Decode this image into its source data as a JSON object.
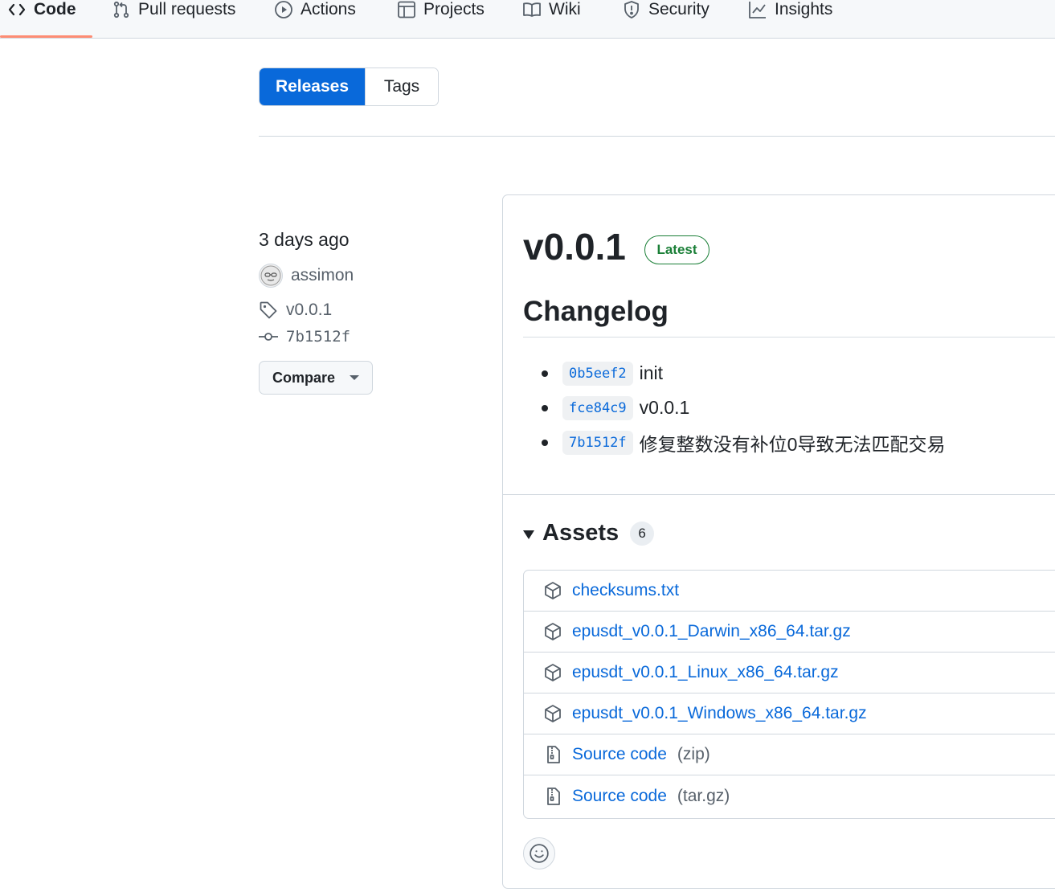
{
  "nav": {
    "tabs": [
      {
        "label": "Code",
        "icon": "code-icon",
        "selected": true
      },
      {
        "label": "Pull requests",
        "icon": "pull-request-icon"
      },
      {
        "label": "Actions",
        "icon": "play-icon"
      },
      {
        "label": "Projects",
        "icon": "table-icon"
      },
      {
        "label": "Wiki",
        "icon": "book-icon"
      },
      {
        "label": "Security",
        "icon": "shield-icon"
      },
      {
        "label": "Insights",
        "icon": "graph-icon"
      }
    ]
  },
  "toggle": {
    "releases": "Releases",
    "tags": "Tags"
  },
  "meta": {
    "date": "3 days ago",
    "author": "assimon",
    "tag": "v0.0.1",
    "commit": "7b1512f",
    "compare": "Compare"
  },
  "release": {
    "title": "v0.0.1",
    "badge": "Latest",
    "changelog_heading": "Changelog",
    "changelog": [
      {
        "sha": "0b5eef2",
        "message": "init"
      },
      {
        "sha": "fce84c9",
        "message": "v0.0.1"
      },
      {
        "sha": "7b1512f",
        "message": "修复整数没有补位0导致无法匹配交易"
      }
    ]
  },
  "assets": {
    "heading": "Assets",
    "count": "6",
    "items": [
      {
        "name": "checksums.txt",
        "suffix": "",
        "icon": "package-icon"
      },
      {
        "name": "epusdt_v0.0.1_Darwin_x86_64.tar.gz",
        "suffix": "",
        "icon": "package-icon"
      },
      {
        "name": "epusdt_v0.0.1_Linux_x86_64.tar.gz",
        "suffix": "",
        "icon": "package-icon"
      },
      {
        "name": "epusdt_v0.0.1_Windows_x86_64.tar.gz",
        "suffix": "",
        "icon": "package-icon"
      },
      {
        "name": "Source code",
        "suffix": "(zip)",
        "icon": "file-zip-icon"
      },
      {
        "name": "Source code",
        "suffix": "(tar.gz)",
        "icon": "file-zip-icon"
      }
    ]
  },
  "colors": {
    "accent": "#0969da",
    "success": "#1a7f37",
    "underline": "#fd8c73",
    "border": "#d0d7de"
  }
}
